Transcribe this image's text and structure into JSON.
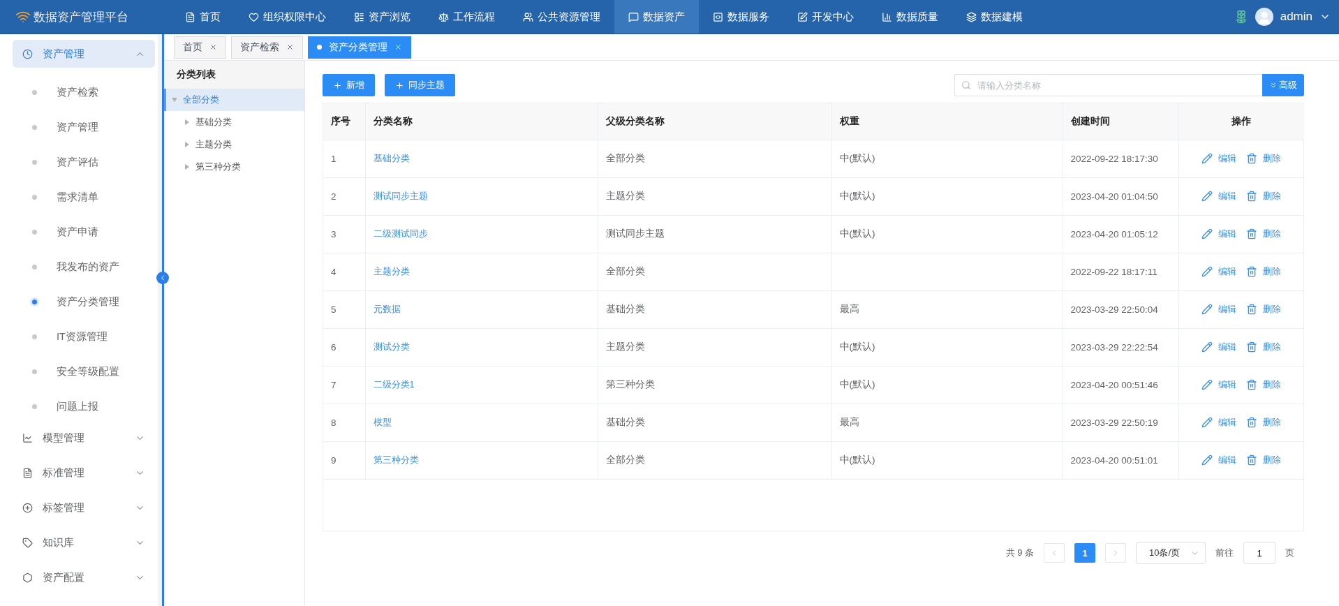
{
  "app": {
    "title": "数据资产管理平台"
  },
  "top_nav": [
    {
      "label": "首页",
      "selected": false
    },
    {
      "label": "组织权限中心",
      "selected": false
    },
    {
      "label": "资产浏览",
      "selected": false
    },
    {
      "label": "工作流程",
      "selected": false
    },
    {
      "label": "公共资源管理",
      "selected": false
    },
    {
      "label": "数据资产",
      "selected": true
    },
    {
      "label": "数据服务",
      "selected": false
    },
    {
      "label": "开发中心",
      "selected": false
    },
    {
      "label": "数据质量",
      "selected": false
    },
    {
      "label": "数据建模",
      "selected": false
    }
  ],
  "user": {
    "name": "admin"
  },
  "sidebar": {
    "groups": [
      {
        "label": "资产管理",
        "expanded": true,
        "selected": true,
        "children": [
          {
            "label": "资产检索",
            "selected": false
          },
          {
            "label": "资产管理",
            "selected": false
          },
          {
            "label": "资产评估",
            "selected": false
          },
          {
            "label": "需求清单",
            "selected": false
          },
          {
            "label": "资产申请",
            "selected": false
          },
          {
            "label": "我发布的资产",
            "selected": false
          },
          {
            "label": "资产分类管理",
            "selected": true
          },
          {
            "label": "IT资源管理",
            "selected": false
          },
          {
            "label": "安全等级配置",
            "selected": false
          },
          {
            "label": "问题上报",
            "selected": false
          }
        ]
      },
      {
        "label": "模型管理",
        "expanded": false,
        "selected": false
      },
      {
        "label": "标准管理",
        "expanded": false,
        "selected": false
      },
      {
        "label": "标签管理",
        "expanded": false,
        "selected": false
      },
      {
        "label": "知识库",
        "expanded": false,
        "selected": false
      },
      {
        "label": "资产配置",
        "expanded": false,
        "selected": false
      }
    ]
  },
  "tabs": [
    {
      "label": "首页",
      "selected": false
    },
    {
      "label": "资产检索",
      "selected": false
    },
    {
      "label": "资产分类管理",
      "selected": true
    }
  ],
  "tree": {
    "title": "分类列表",
    "items": [
      {
        "label": "全部分类",
        "expanded": true,
        "selected": true,
        "children": [
          {
            "label": "基础分类",
            "expanded": false,
            "selected": false
          },
          {
            "label": "主题分类",
            "expanded": false,
            "selected": false
          },
          {
            "label": "第三种分类",
            "expanded": false,
            "selected": false
          }
        ]
      }
    ]
  },
  "toolbar": {
    "buttons": [
      "新增",
      "同步主题"
    ],
    "search": {
      "placeholder": "请输入分类名称"
    },
    "advanced": "高级"
  },
  "table": {
    "columns": [
      "序号",
      "分类名称",
      "父级分类名称",
      "权重",
      "创建时间",
      "操作"
    ],
    "rows": [
      {
        "index": "1",
        "name": "基础分类",
        "parent": "全部分类",
        "weight": "中(默认)",
        "created": "2022-09-22 18:17:30",
        "actions": [
          "编辑",
          "删除"
        ]
      },
      {
        "index": "2",
        "name": "测试同步主题",
        "parent": "主题分类",
        "weight": "中(默认)",
        "created": "2023-04-20 01:04:50",
        "actions": [
          "编辑",
          "删除"
        ]
      },
      {
        "index": "3",
        "name": "二级测试同步",
        "parent": "测试同步主题",
        "weight": "中(默认)",
        "created": "2023-04-20 01:05:12",
        "actions": [
          "编辑",
          "删除"
        ]
      },
      {
        "index": "4",
        "name": "主题分类",
        "parent": "全部分类",
        "created": "2022-09-22 18:17:11",
        "actions": [
          "编辑",
          "删除"
        ]
      },
      {
        "index": "5",
        "name": "元数据",
        "parent": "基础分类",
        "weight": "最高",
        "created": "2023-03-29 22:50:04",
        "actions": [
          "编辑",
          "删除"
        ]
      },
      {
        "index": "6",
        "name": "测试分类",
        "parent": "主题分类",
        "weight": "中(默认)",
        "created": "2023-03-29 22:22:54",
        "actions": [
          "编辑",
          "删除"
        ]
      },
      {
        "index": "7",
        "name": "二级分类1",
        "parent": "第三种分类",
        "weight": "中(默认)",
        "created": "2023-04-20 00:51:46",
        "actions": [
          "编辑",
          "删除"
        ]
      },
      {
        "index": "8",
        "name": "模型",
        "parent": "基础分类",
        "weight": "最高",
        "created": "2023-03-29 22:50:19",
        "actions": [
          "编辑",
          "删除"
        ]
      },
      {
        "index": "9",
        "name": "第三种分类",
        "parent": "全部分类",
        "weight": "中(默认)",
        "created": "2023-04-20 00:51:01",
        "actions": [
          "编辑",
          "删除"
        ]
      }
    ]
  },
  "pagination": {
    "total": "共 9 条",
    "pages": [
      {
        "label": "1",
        "selected": true
      }
    ],
    "page_size": "10条/页",
    "goto_label": "前往",
    "goto_value": "1",
    "page_suffix": "页"
  }
}
